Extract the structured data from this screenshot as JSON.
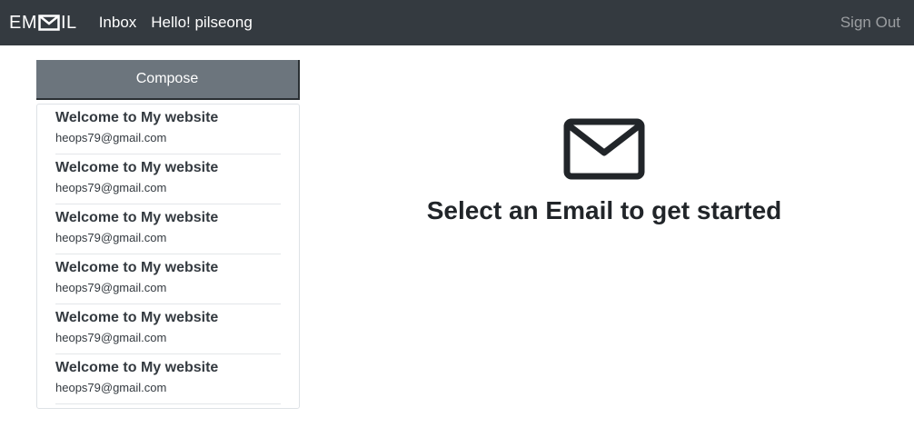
{
  "navbar": {
    "brand": {
      "prefix": "EM",
      "suffix": "IL",
      "icon": "envelope-logo-icon"
    },
    "inbox_label": "Inbox",
    "greeting": "Hello! pilseong",
    "signout_label": "Sign Out"
  },
  "sidebar": {
    "compose_label": "Compose",
    "emails": [
      {
        "subject": "Welcome to My website",
        "sender": "heops79@gmail.com"
      },
      {
        "subject": "Welcome to My website",
        "sender": "heops79@gmail.com"
      },
      {
        "subject": "Welcome to My website",
        "sender": "heops79@gmail.com"
      },
      {
        "subject": "Welcome to My website",
        "sender": "heops79@gmail.com"
      },
      {
        "subject": "Welcome to My website",
        "sender": "heops79@gmail.com"
      },
      {
        "subject": "Welcome to My website",
        "sender": "heops79@gmail.com"
      }
    ]
  },
  "main": {
    "icon": "envelope-icon",
    "message": "Select an Email to get started"
  },
  "colors": {
    "navbar_bg": "#343a40",
    "compose_bg": "#6c757d",
    "signout_text": "rgba(255,255,255,0.5)"
  }
}
